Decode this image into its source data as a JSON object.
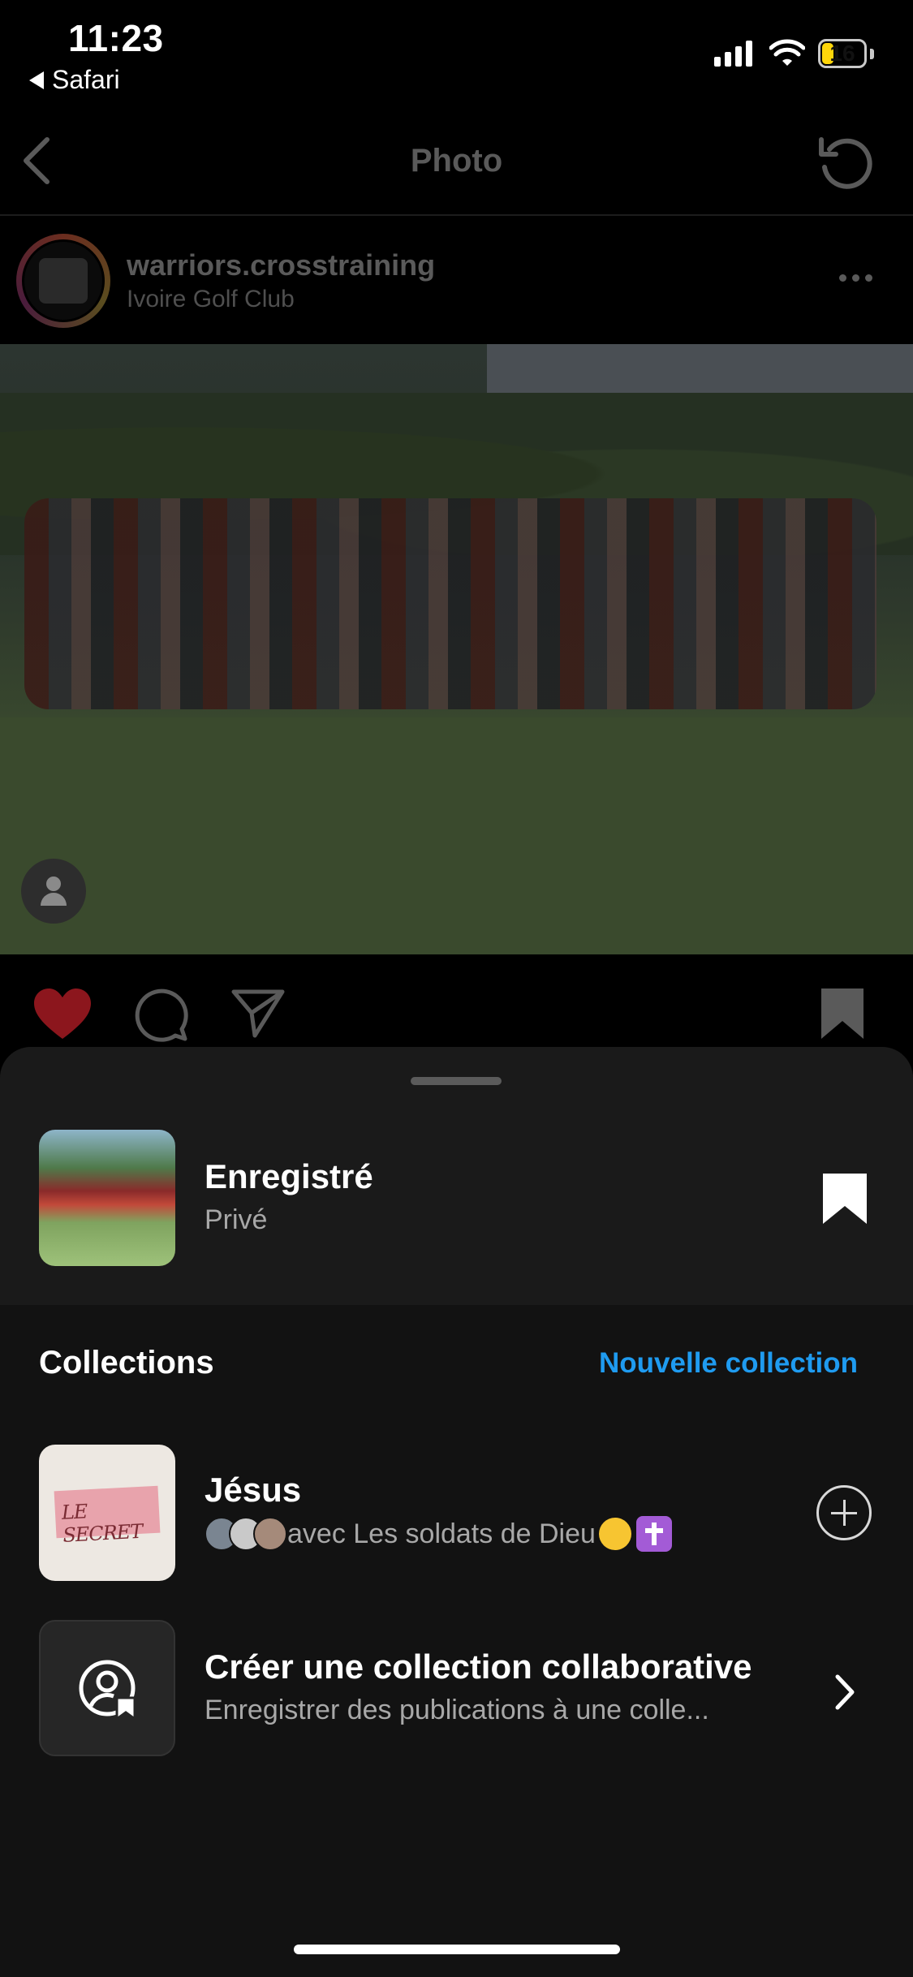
{
  "status_bar": {
    "time": "11:23",
    "back_app": "Safari",
    "battery": "16",
    "battery_color": "#ffd60a"
  },
  "nav": {
    "title": "Photo",
    "back_icon": "chevron-left-icon",
    "refresh_icon": "refresh-icon"
  },
  "post": {
    "username": "warriors.crosstraining",
    "location": "Ivoire Golf Club",
    "liked": true,
    "like_color": "#c4202a"
  },
  "sheet": {
    "saved_title": "Enregistré",
    "saved_subtitle": "Privé",
    "collections_title": "Collections",
    "new_collection": "Nouvelle collection",
    "accent_color": "#1f9bf0",
    "collections": [
      {
        "name": "Jésus",
        "thumb_text": "LE SECRET",
        "subtitle": "avec Les soldats de Dieu"
      }
    ],
    "collab": {
      "title": "Créer une collection collaborative",
      "subtitle": "Enregistrer des publications à une colle..."
    }
  }
}
